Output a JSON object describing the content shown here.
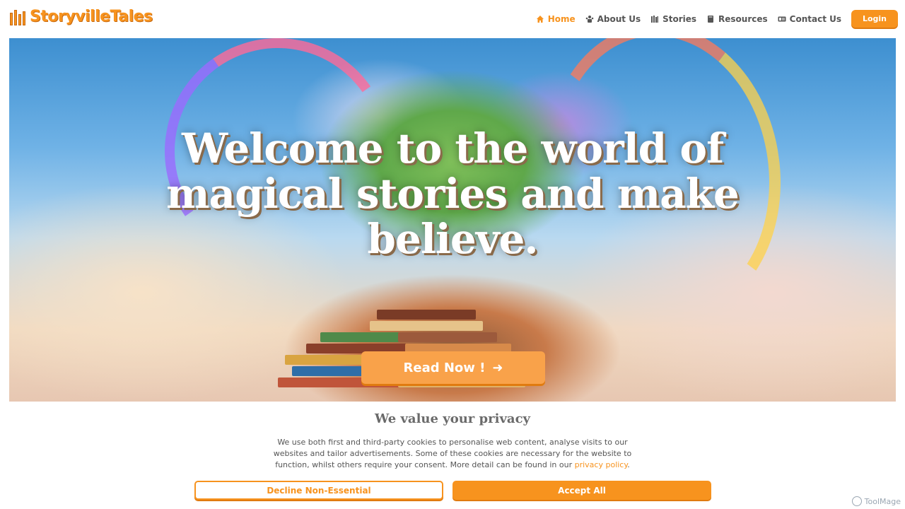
{
  "header": {
    "logo_text": "StoryvilleTales",
    "nav": [
      {
        "label": "Home",
        "icon": "home-icon"
      },
      {
        "label": "About Us",
        "icon": "people-icon"
      },
      {
        "label": "Stories",
        "icon": "books-icon"
      },
      {
        "label": "Resources",
        "icon": "book-icon"
      },
      {
        "label": "Contact Us",
        "icon": "id-card-icon"
      }
    ],
    "login_label": "Login"
  },
  "hero": {
    "title_line1": "Welcome to the world of",
    "title_line2": "magical stories and make",
    "title_line3": "believe.",
    "cta_label": "Read Now !",
    "cta_icon": "arrow-right-icon"
  },
  "privacy": {
    "title": "We value your privacy",
    "text_line1": "We use both first and third-party cookies to personalise web content, analyse visits to our",
    "text_line2": "websites and tailor advertisements. Some of these cookies are necessary for the website to",
    "text_line3_prefix": "function, whilst others require your consent. More detail can be found in our ",
    "text_link": "privacy policy",
    "text_suffix": ".",
    "decline_label": "Decline Non-Essential",
    "accept_label": "Accept All"
  },
  "watermark": {
    "text": "ToolMage"
  },
  "colors": {
    "accent": "#f7931e",
    "text": "#555555"
  }
}
